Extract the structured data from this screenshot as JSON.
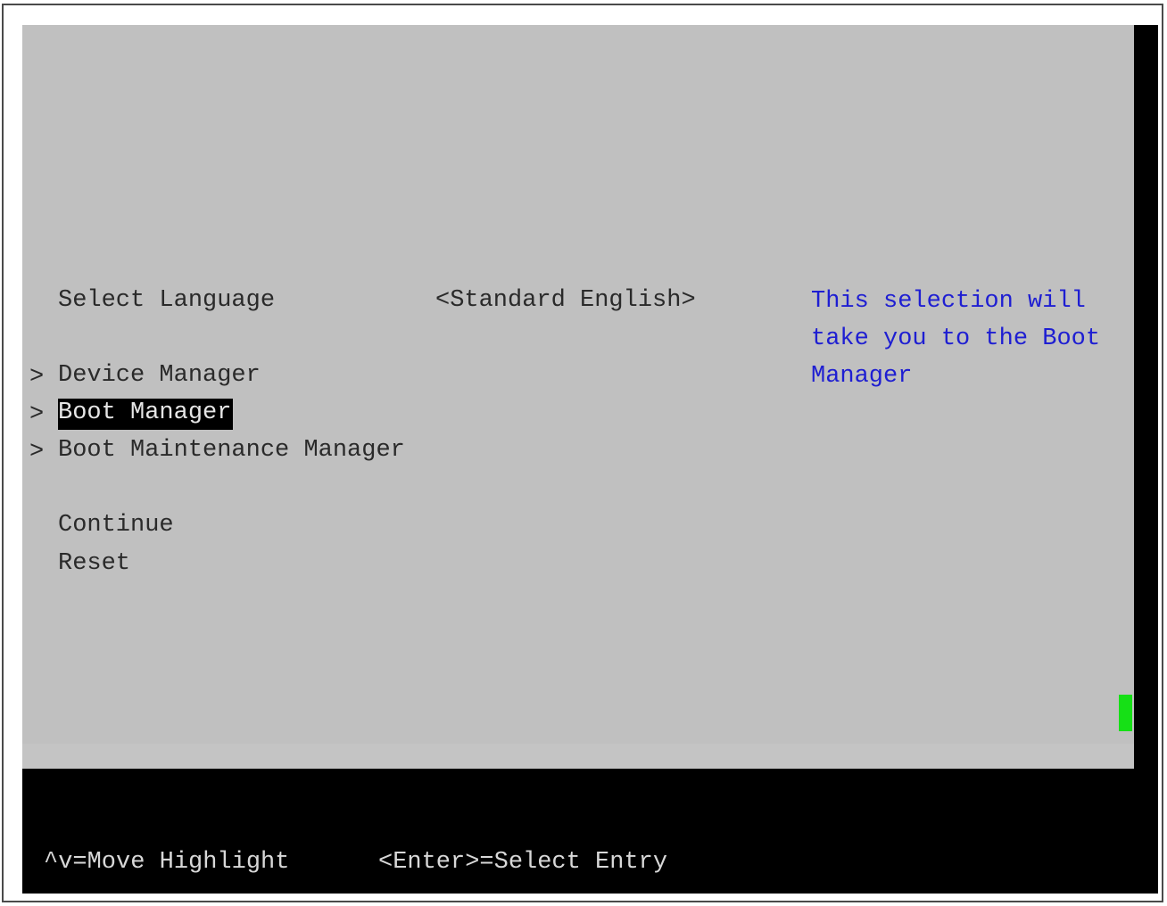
{
  "menu": {
    "select_language": {
      "label": "Select Language",
      "value": "<Standard English>"
    },
    "items": [
      {
        "arrow": ">",
        "label": "Device Manager"
      },
      {
        "arrow": ">",
        "label": "Boot Manager",
        "highlighted": true
      },
      {
        "arrow": ">",
        "label": "Boot Maintenance Manager"
      }
    ],
    "continue_label": "Continue",
    "reset_label": "Reset"
  },
  "help_text": "This selection will\ntake you to the Boot\nManager",
  "footer": {
    "move_hint": "^v=Move Highlight",
    "select_hint": "<Enter>=Select Entry"
  },
  "colors": {
    "background": "#c0c0c0",
    "help_text": "#1e1ed2",
    "cursor": "#16e016",
    "footer_bg": "#000000"
  }
}
